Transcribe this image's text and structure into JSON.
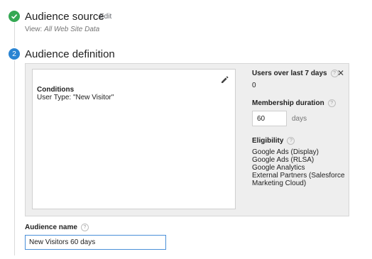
{
  "steps": {
    "source": {
      "number": "1",
      "title": "Audience source",
      "edit_label": "Edit",
      "view_prefix": "View:",
      "view_name": "All Web Site Data"
    },
    "definition": {
      "number": "2",
      "title": "Audience definition"
    }
  },
  "conditions": {
    "title": "Conditions",
    "text": "User Type: \"New Visitor\""
  },
  "side": {
    "users_label": "Users over last 7 days",
    "users_value": "0",
    "membership_label": "Membership duration",
    "membership_value": "60",
    "membership_unit": "days",
    "eligibility_label": "Eligibility",
    "eligibility_items": [
      "Google Ads (Display)",
      "Google Ads (RLSA)",
      "Google Analytics",
      "External Partners (Salesforce",
      "Marketing Cloud)"
    ],
    "help_glyph": "?",
    "close_glyph": "✕"
  },
  "audience_name": {
    "label": "Audience name",
    "value": "New Visitors 60 days"
  },
  "colors": {
    "complete": "#34a853",
    "active": "#2a84d2",
    "focus": "#4a90d9"
  },
  "icons": {
    "step1": "check-icon",
    "edit": "pencil-icon",
    "close": "close-icon",
    "help": "help-icon"
  }
}
